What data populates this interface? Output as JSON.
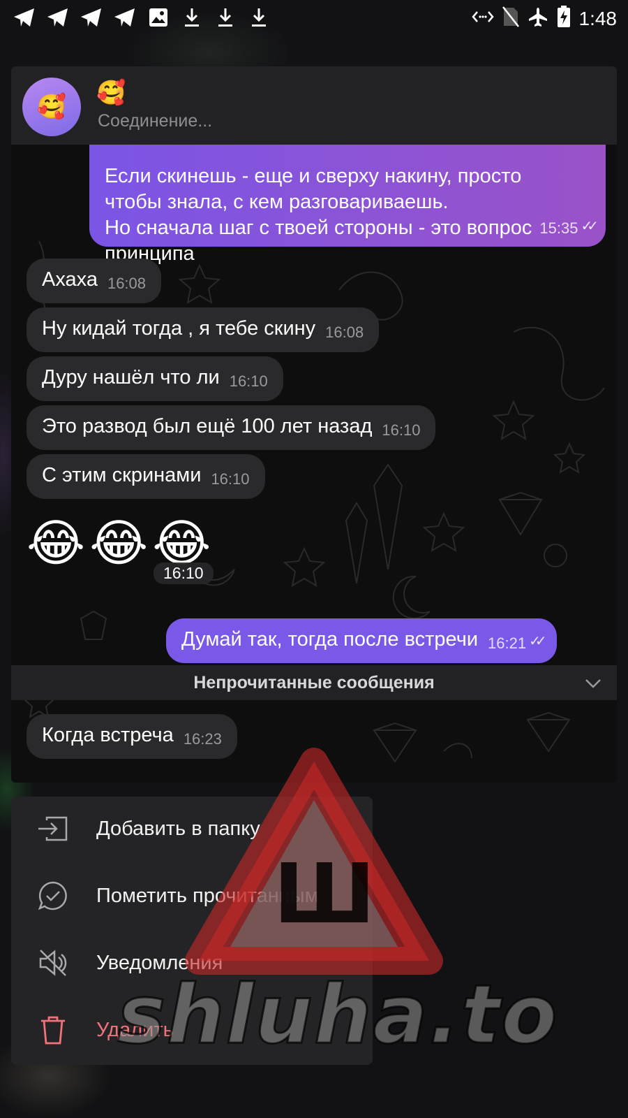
{
  "status_bar": {
    "time": "1:48"
  },
  "chat": {
    "title_emoji": "🥰",
    "avatar_emoji": "🥰",
    "status": "Соединение...",
    "messages": [
      {
        "dir": "out",
        "text": "Если скинешь - еще и сверху накину, просто\nчтобы знала, с кем разговариваешь.\nНо сначала шаг с твоей стороны - это вопрос\nпринципа",
        "time": "15:35",
        "read": true
      },
      {
        "dir": "in",
        "text": "Ахаха",
        "time": "16:08"
      },
      {
        "dir": "in",
        "text": "Ну кидай тогда , я тебе скину",
        "time": "16:08"
      },
      {
        "dir": "in",
        "text": "Дуру нашёл что ли",
        "time": "16:10"
      },
      {
        "dir": "in",
        "text": "Это развод был ещё 100 лет назад",
        "time": "16:10"
      },
      {
        "dir": "in",
        "text": "С этим скринами",
        "time": "16:10"
      },
      {
        "dir": "in",
        "text": "😂😂😂",
        "time": "16:10"
      },
      {
        "dir": "out",
        "text": "Думай так, тогда после встречи",
        "time": "16:21",
        "read": true
      },
      {
        "dir": "in",
        "text": "Когда встреча",
        "time": "16:23"
      }
    ],
    "unread_label": "Непрочитанные сообщения"
  },
  "menu": {
    "items": [
      {
        "label": "Добавить в папку",
        "icon": "folder-add-icon"
      },
      {
        "label": "Пометить прочитанным",
        "icon": "chat-check-icon"
      },
      {
        "label": "Уведомления",
        "icon": "mute-icon"
      },
      {
        "label": "Удалить",
        "icon": "trash-icon",
        "color": "#f0727a"
      }
    ]
  },
  "watermark": {
    "text": "shluha.to",
    "logo_letter": "Ш"
  },
  "colors": {
    "accent": "#7a58e8",
    "danger": "#f0727a",
    "header": "#222224"
  }
}
